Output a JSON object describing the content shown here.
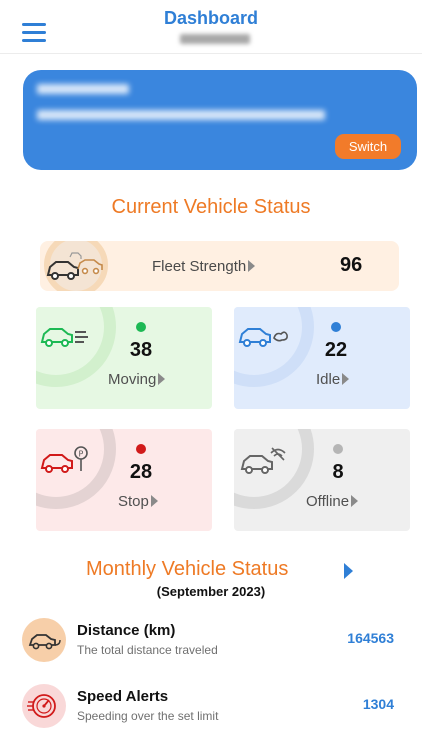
{
  "header": {
    "title": "Dashboard",
    "menu_icon": "hamburger-menu-icon"
  },
  "account": {
    "switch_label": "Switch",
    "accent_color": "#3a86de",
    "button_color": "#f27b2a"
  },
  "current_status": {
    "title": "Current Vehicle Status",
    "fleet": {
      "label": "Fleet Strength",
      "value": "96"
    },
    "cards": {
      "moving": {
        "label": "Moving",
        "value": "38",
        "color": "#1db954"
      },
      "idle": {
        "label": "Idle",
        "value": "22",
        "color": "#2f7fd6"
      },
      "stop": {
        "label": "Stop",
        "value": "28",
        "color": "#d11a1a"
      },
      "offline": {
        "label": "Offline",
        "value": "8",
        "color": "#b5b5b5"
      }
    }
  },
  "monthly_status": {
    "title": "Monthly Vehicle Status",
    "period": "(September 2023)",
    "metrics": [
      {
        "name": "Distance (km)",
        "description": "The total distance traveled",
        "value": "164563",
        "icon": "car-distance-icon"
      },
      {
        "name": "Speed Alerts",
        "description": "Speeding over the set limit",
        "value": "1304",
        "icon": "speedometer-icon"
      }
    ]
  }
}
